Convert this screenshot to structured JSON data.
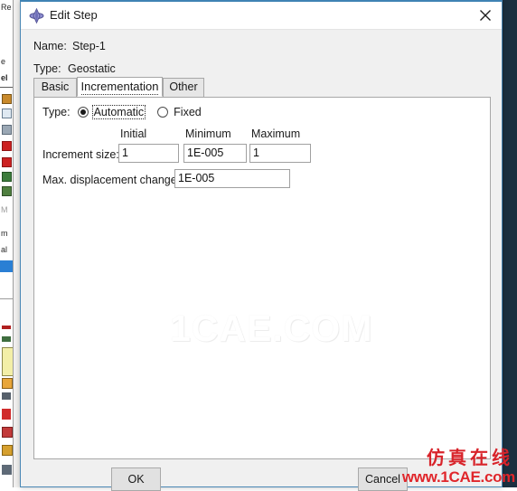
{
  "window": {
    "title": "Edit Step",
    "icon": "abaqus-diamond-icon",
    "close_label": "✕",
    "accent_color": "#3f83b4"
  },
  "header": {
    "name_label": "Name:",
    "name_value": "Step-1",
    "type_label": "Type:",
    "type_value": "Geostatic"
  },
  "tabs": [
    {
      "label": "Basic",
      "active": false
    },
    {
      "label": "Incrementation",
      "active": true
    },
    {
      "label": "Other",
      "active": false
    }
  ],
  "incrementation": {
    "type_label": "Type:",
    "options": [
      {
        "label": "Automatic",
        "selected": true,
        "focused": true
      },
      {
        "label": "Fixed",
        "selected": false,
        "focused": false
      }
    ],
    "columns": [
      "Initial",
      "Minimum",
      "Maximum"
    ],
    "increment_size_label": "Increment size:",
    "increment_size_values": [
      "1",
      "1E-005",
      "1"
    ],
    "max_displacement_label": "Max. displacement change:",
    "max_displacement_value": "1E-005"
  },
  "footer": {
    "ok_label": "OK",
    "cancel_label": "Cancel"
  },
  "watermarks": {
    "center": "1CAE.COM",
    "corner_cn": "仿真在线",
    "corner_url": "www.1CAE.com",
    "corner_color": "#d8232a"
  },
  "background": {
    "tree_rows": [
      {
        "text": "Re",
        "selected": false
      },
      {
        "text": "",
        "selected": false
      },
      {
        "text": "",
        "selected": false
      },
      {
        "text": "e",
        "selected": false
      },
      {
        "text": "el",
        "selected": false
      },
      {
        "text": "",
        "selected": false
      },
      {
        "text": "",
        "selected": false
      },
      {
        "text": "",
        "selected": false
      },
      {
        "text": "",
        "selected": false
      },
      {
        "text": "",
        "selected": false
      },
      {
        "text": "M",
        "selected": false
      },
      {
        "text": "m",
        "selected": false
      },
      {
        "text": "al",
        "selected": false
      },
      {
        "text": "",
        "selected": true
      },
      {
        "text": "",
        "selected": false
      },
      {
        "text": "",
        "selected": false
      }
    ]
  }
}
